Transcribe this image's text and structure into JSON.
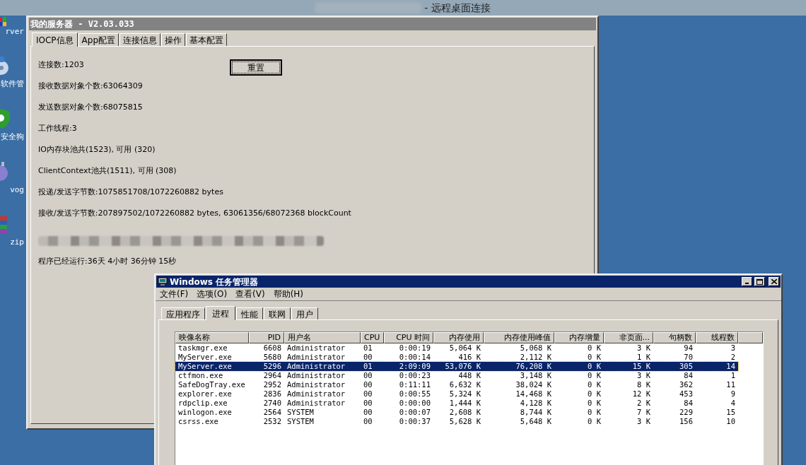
{
  "rdp_title": "- 远程桌面连接",
  "desktop_icons": [
    "rver",
    "软件管",
    "安全狗",
    "vog",
    "zip"
  ],
  "server_window": {
    "title": "我的服务器 - V2.03.033",
    "tabs": [
      {
        "label": "IOCP信息",
        "selected": true
      },
      {
        "label": "App配置",
        "selected": false
      },
      {
        "label": "连接信息",
        "selected": false
      },
      {
        "label": "操作",
        "selected": false
      },
      {
        "label": "基本配置",
        "selected": false
      }
    ],
    "reset_button": "重置",
    "stats": [
      "连接数:1203",
      "接收数据对象个数:63064309",
      "发送数据对象个数:68075815",
      "工作线程:3",
      "IO内存块池共(1523), 可用 (320)",
      "ClientContext池共(1511), 可用 (308)",
      "投递/发送字节数:1075851708/1072260882 bytes",
      "接收/发送字节数:207897502/1072260882 bytes, 63061356/68072368 blockCount"
    ],
    "uptime": "程序已经运行:36天 4小时 36分钟 15秒"
  },
  "task_manager": {
    "title": "Windows 任务管理器",
    "menu": [
      "文件(F)",
      "选项(O)",
      "查看(V)",
      "帮助(H)"
    ],
    "tabs": [
      {
        "label": "应用程序",
        "selected": false
      },
      {
        "label": "进程",
        "selected": true
      },
      {
        "label": "性能",
        "selected": false
      },
      {
        "label": "联网",
        "selected": false
      },
      {
        "label": "用户",
        "selected": false
      }
    ],
    "columns": [
      "映像名称",
      "PID",
      "用户名",
      "CPU",
      "CPU 时间",
      "内存使用",
      "内存使用峰值",
      "内存增量",
      "非页面...",
      "句柄数",
      "线程数"
    ],
    "rows": [
      {
        "selected": false,
        "cells": [
          "taskmgr.exe",
          "6608",
          "Administrator",
          "01",
          "0:00:19",
          "5,064 K",
          "5,068 K",
          "0 K",
          "3 K",
          "94",
          "3"
        ]
      },
      {
        "selected": false,
        "cells": [
          "MyServer.exe",
          "5680",
          "Administrator",
          "00",
          "0:00:14",
          "416 K",
          "2,112 K",
          "0 K",
          "1 K",
          "70",
          "2"
        ]
      },
      {
        "selected": true,
        "cells": [
          "MyServer.exe",
          "5296",
          "Administrator",
          "01",
          "2:09:09",
          "53,076 K",
          "76,208 K",
          "0 K",
          "15 K",
          "305",
          "14"
        ]
      },
      {
        "selected": false,
        "cells": [
          "ctfmon.exe",
          "2964",
          "Administrator",
          "00",
          "0:00:23",
          "448 K",
          "3,148 K",
          "0 K",
          "3 K",
          "84",
          "1"
        ]
      },
      {
        "selected": false,
        "cells": [
          "SafeDogTray.exe",
          "2952",
          "Administrator",
          "00",
          "0:11:11",
          "6,632 K",
          "38,024 K",
          "0 K",
          "8 K",
          "362",
          "11"
        ]
      },
      {
        "selected": false,
        "cells": [
          "explorer.exe",
          "2836",
          "Administrator",
          "00",
          "0:00:55",
          "5,324 K",
          "14,468 K",
          "0 K",
          "12 K",
          "453",
          "9"
        ]
      },
      {
        "selected": false,
        "cells": [
          "rdpclip.exe",
          "2740",
          "Administrator",
          "00",
          "0:00:00",
          "1,444 K",
          "4,128 K",
          "0 K",
          "2 K",
          "84",
          "4"
        ]
      },
      {
        "selected": false,
        "cells": [
          "winlogon.exe",
          "2564",
          "SYSTEM",
          "00",
          "0:00:07",
          "2,608 K",
          "8,744 K",
          "0 K",
          "7 K",
          "229",
          "15"
        ]
      },
      {
        "selected": false,
        "cells": [
          "csrss.exe",
          "2532",
          "SYSTEM",
          "00",
          "0:00:37",
          "5,628 K",
          "5,648 K",
          "0 K",
          "3 K",
          "156",
          "10"
        ]
      }
    ]
  }
}
